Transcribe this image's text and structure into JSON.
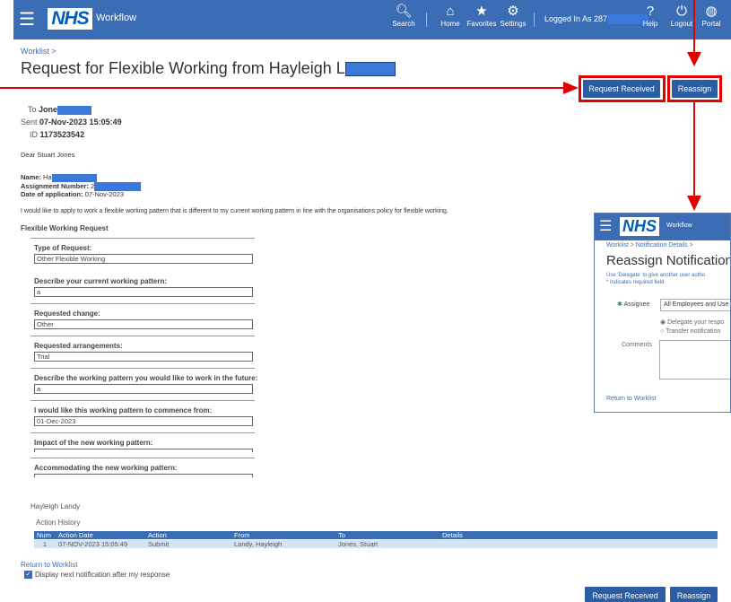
{
  "header": {
    "logo": "NHS",
    "app_title": "Workflow",
    "nav": [
      {
        "label": "Search",
        "icon": "search-icon"
      },
      {
        "label": "Home",
        "icon": "home-icon"
      },
      {
        "label": "Favorites",
        "icon": "star-icon"
      },
      {
        "label": "Settings",
        "icon": "gear-icon"
      }
    ],
    "logged_in": "Logged In As 287",
    "help": "Help",
    "logout": "Logout",
    "portal": "Portal"
  },
  "breadcrumb": "Worklist >",
  "page_title": "Request for Flexible Working from Hayleigh L",
  "actions": {
    "request_received": "Request Received",
    "reassign": "Reassign"
  },
  "notification": {
    "to_label": "To",
    "to_value": "Jone",
    "sent_label": "Sent",
    "sent_value": "07-Nov-2023 15:05:49",
    "id_label": "ID",
    "id_value": "1173523542"
  },
  "body": {
    "greeting": "Dear Stuart Jones",
    "name_label": "Name:",
    "name_value": "Ha",
    "assignment_label": "Assignment Number:",
    "assignment_value": "2",
    "date_label": "Date of application:",
    "date_value": "07-Nov-2023",
    "intro": "I would like to apply to work a flexible working pattern that is different to my current working pattern in line with the organisations policy for flexible working.",
    "section_title": "Flexible Working Request"
  },
  "fields": [
    {
      "label": "Type of Request:",
      "value": "Other Flexible Working"
    },
    {
      "label": "Describe your current working pattern:",
      "value": "a"
    },
    {
      "label": "Requested change:",
      "value": "Other"
    },
    {
      "label": "Requested arrangements:",
      "value": "Trial"
    },
    {
      "label": "Describe the working pattern you would like to work in the future:",
      "value": "a"
    },
    {
      "label": "I would like this working pattern to commence from:",
      "value": "01-Dec-2023"
    },
    {
      "label": "Impact of the new working pattern:",
      "value": ""
    },
    {
      "label": "Accommodating the new working pattern:",
      "value": ""
    }
  ],
  "signature": "Hayleigh Landy",
  "action_history": {
    "title": "Action History",
    "columns": [
      "Num",
      "Action Date",
      "Action",
      "From",
      "To",
      "Details"
    ],
    "rows": [
      [
        "1",
        "07-NOV-2023 15:05:49",
        "Submit",
        "Landy, Hayleigh",
        "Jones, Stuart",
        ""
      ]
    ]
  },
  "return_link": "Return to Worklist",
  "display_next": "Display next notification after my response",
  "popup": {
    "logo": "NHS",
    "app_title": "Workflow",
    "breadcrumb": "Worklist > Notification Details >",
    "title": "Reassign Notification",
    "help": "Use 'Delegate' to give another user autho",
    "required": "* Indicates required field",
    "assignee_label": "Assignee",
    "assignee_value": "All Employees and Use",
    "option_delegate": "Delegate your respo",
    "option_transfer": "Transfer notification",
    "comments_label": "Comments",
    "return_link": "Return to Worklist"
  },
  "colors": {
    "header": "#3a6db3",
    "button": "#2b5da3",
    "highlight": "#e00000",
    "link": "#3a6db3"
  }
}
